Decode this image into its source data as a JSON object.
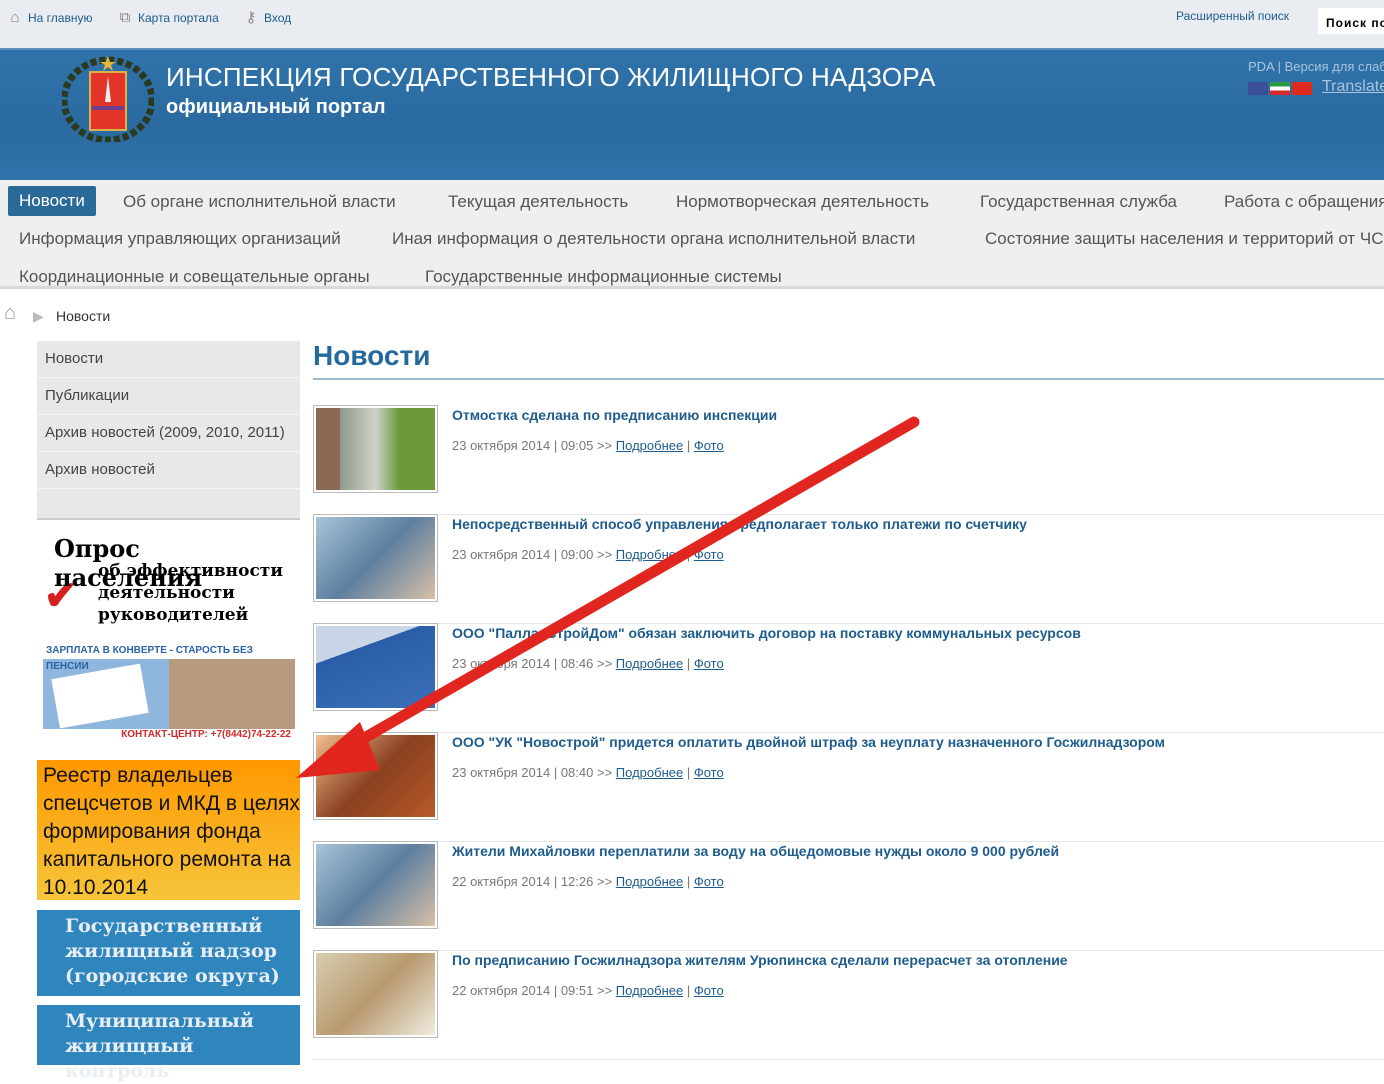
{
  "topbar": {
    "home": "На главную",
    "sitemap": "Карта портала",
    "login": "Вход",
    "advanced_search": "Расширенный поиск",
    "search_placeholder": "Поиск по"
  },
  "header": {
    "title": "ИНСПЕКЦИЯ ГОСУДАРСТВЕННОГО ЖИЛИЩНОГО НАДЗОРА",
    "subtitle": "официальный портал",
    "pda": "PDA | Версия для слабовидящих",
    "translate": "Translate"
  },
  "nav": [
    "Новости",
    "Об органе исполнительной власти",
    "Текущая деятельность",
    "Нормотворческая деятельность",
    "Государственная служба",
    "Работа с обращениями",
    "Информация управляющих организаций",
    "Иная информация о деятельности органа исполнительной власти",
    "Состояние защиты населения и территорий от ЧС",
    "Координационные и совещательные органы",
    "Государственные информационные системы"
  ],
  "breadcrumb": {
    "current": "Новости"
  },
  "sidebar": {
    "items": [
      "Новости",
      "Публикации",
      "Архив новостей (2009, 2010, 2011)",
      "Архив новостей"
    ],
    "poll": {
      "l1": "Опрос населения",
      "l2": "об эффективности",
      "l3": "деятельности",
      "l4": "руководителей"
    },
    "salary": {
      "top": "ЗАРПЛАТА В КОНВЕРТЕ - СТАРОСТЬ БЕЗ ПЕНСИИ",
      "bottom": "КОНТАКТ-ЦЕНТР: +7(8442)74-22-22"
    },
    "registry": "Реестр владельцев спецсчетов и МКД в целях формирования фонда капитального ремонта на 10.10.2014",
    "banner1": "Государственный жилищный надзор (городские округа)",
    "banner2": "Муниципальный жилищный контроль"
  },
  "page": {
    "title": "Новости",
    "more": "Подробнее",
    "photo": "Фото"
  },
  "news": [
    {
      "title": "Отмостка сделана по предписанию инспекции",
      "date": "23 октября 2014 | 09:05 >>"
    },
    {
      "title": "Непосредственный способ управления предполагает только платежи по счетчику",
      "date": "23 октября 2014 | 09:00 >>"
    },
    {
      "title": "ООО \"ПалласСтройДом\" обязан заключить договор на поставку коммунальных ресурсов",
      "date": "23 октября 2014 | 08:46 >>"
    },
    {
      "title": "ООО \"УК \"Новострой\" придется оплатить двойной штраф за неуплату назначенного Госжилнадзором",
      "date": "23 октября 2014 | 08:40 >>"
    },
    {
      "title": "Жители Михайловки переплатили за воду на общедомовые нужды около 9 000 рублей",
      "date": "22 октября 2014 | 12:26 >>"
    },
    {
      "title": "По предписанию Госжилнадзора жителям Урюпинска сделали перерасчет за отопление",
      "date": "22 октября 2014 | 09:51 >>"
    }
  ],
  "colors": {
    "accent": "#24699e",
    "arrow": "#e0261f",
    "orange": "#ff9800"
  }
}
